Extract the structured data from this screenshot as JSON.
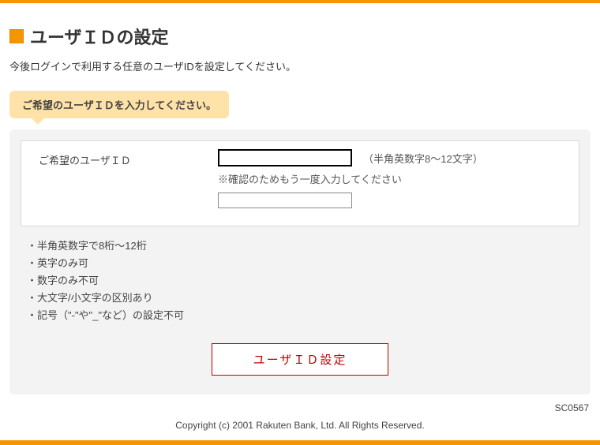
{
  "page": {
    "title": "ユーザＩＤの設定",
    "intro": "今後ログインで利用する任意のユーザIDを設定してください。",
    "bubble": "ご希望のユーザＩＤを入力してください。"
  },
  "form": {
    "label": "ご希望のユーザＩＤ",
    "hint": "（半角英数字8～12文字）",
    "confirm_note": "※確認のためもう一度入力してください",
    "input_value": "",
    "confirm_value": ""
  },
  "rules": [
    "・半角英数字で8桁～12桁",
    "・英字のみ可",
    "・数字のみ不可",
    "・大文字/小文字の区別あり",
    "・記号（\"-\"や\"_\"など）の設定不可"
  ],
  "button": {
    "submit": "ユーザＩＤ設定"
  },
  "footer": {
    "screen_code": "SC0567",
    "copyright": "Copyright (c) 2001 Rakuten Bank, Ltd. All Rights Reserved."
  }
}
